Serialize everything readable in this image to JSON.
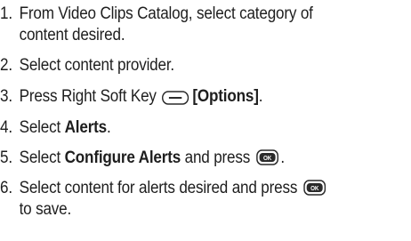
{
  "steps": [
    {
      "num": "1.",
      "line1": "From Video Clips Catalog, select category of",
      "line2": "content desired."
    },
    {
      "num": "2.",
      "text": "Select content provider."
    },
    {
      "num": "3.",
      "prefix": "Press Right Soft Key",
      "icon": "right-soft-key-icon",
      "bold": "[Options]",
      "suffix": "."
    },
    {
      "num": "4.",
      "prefix": "Select ",
      "bold": "Alerts",
      "suffix": "."
    },
    {
      "num": "5.",
      "prefix": "Select ",
      "bold": "Configure Alerts",
      "middle": " and press",
      "icon": "ok-key-icon",
      "icon_label": "OK",
      "suffix": "."
    },
    {
      "num": "6.",
      "line1": "Select content for alerts desired and press",
      "icon": "ok-key-icon",
      "icon_label": "OK",
      "line2": "to save."
    }
  ]
}
